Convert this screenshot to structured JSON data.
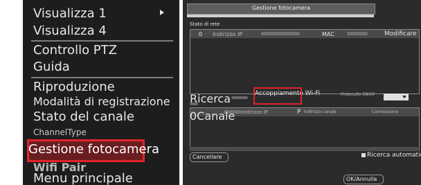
{
  "menu": {
    "items": [
      {
        "label": "Visualizza 1"
      },
      {
        "label": "Visualizza 4"
      },
      {
        "label": "Controllo PTZ"
      },
      {
        "label": "Guida"
      },
      {
        "label": "Riproduzione"
      },
      {
        "label": "Modalità di registrazione"
      },
      {
        "label": "Stato del canale"
      },
      {
        "label": "ChannelType"
      },
      {
        "label": "Gestione fotocamera"
      },
      {
        "label": "Wifi Pair"
      },
      {
        "label": "Menu principale"
      }
    ]
  },
  "dialog": {
    "title": "Gestione fotocamera",
    "section_label": "Stato di rete",
    "table1_headers": {
      "col0": "0",
      "col1": "Indirizzo IP",
      "col3": "MAC",
      "col4": "Modificare"
    },
    "search_button": "Ricerca",
    "wifi_pair_button": "Accoppiamento Wi-Fi",
    "protocol_label": "Protocollo ONVIF",
    "table2_headers": {
      "col0": "0Canale",
      "col1": "Indirizzo IP",
      "col2": "P",
      "col3": "Indirizzo canale",
      "col4": "Connessione"
    },
    "auto_search_label": "Ricerca automatica",
    "cancel_button": "Cancellare",
    "ok_cancel_button": "OK/Annulla"
  },
  "colors": {
    "highlight_border": "#e0242a",
    "menu_bg": "#1d1d1d",
    "dialog_bg": "#2b2b2b"
  }
}
